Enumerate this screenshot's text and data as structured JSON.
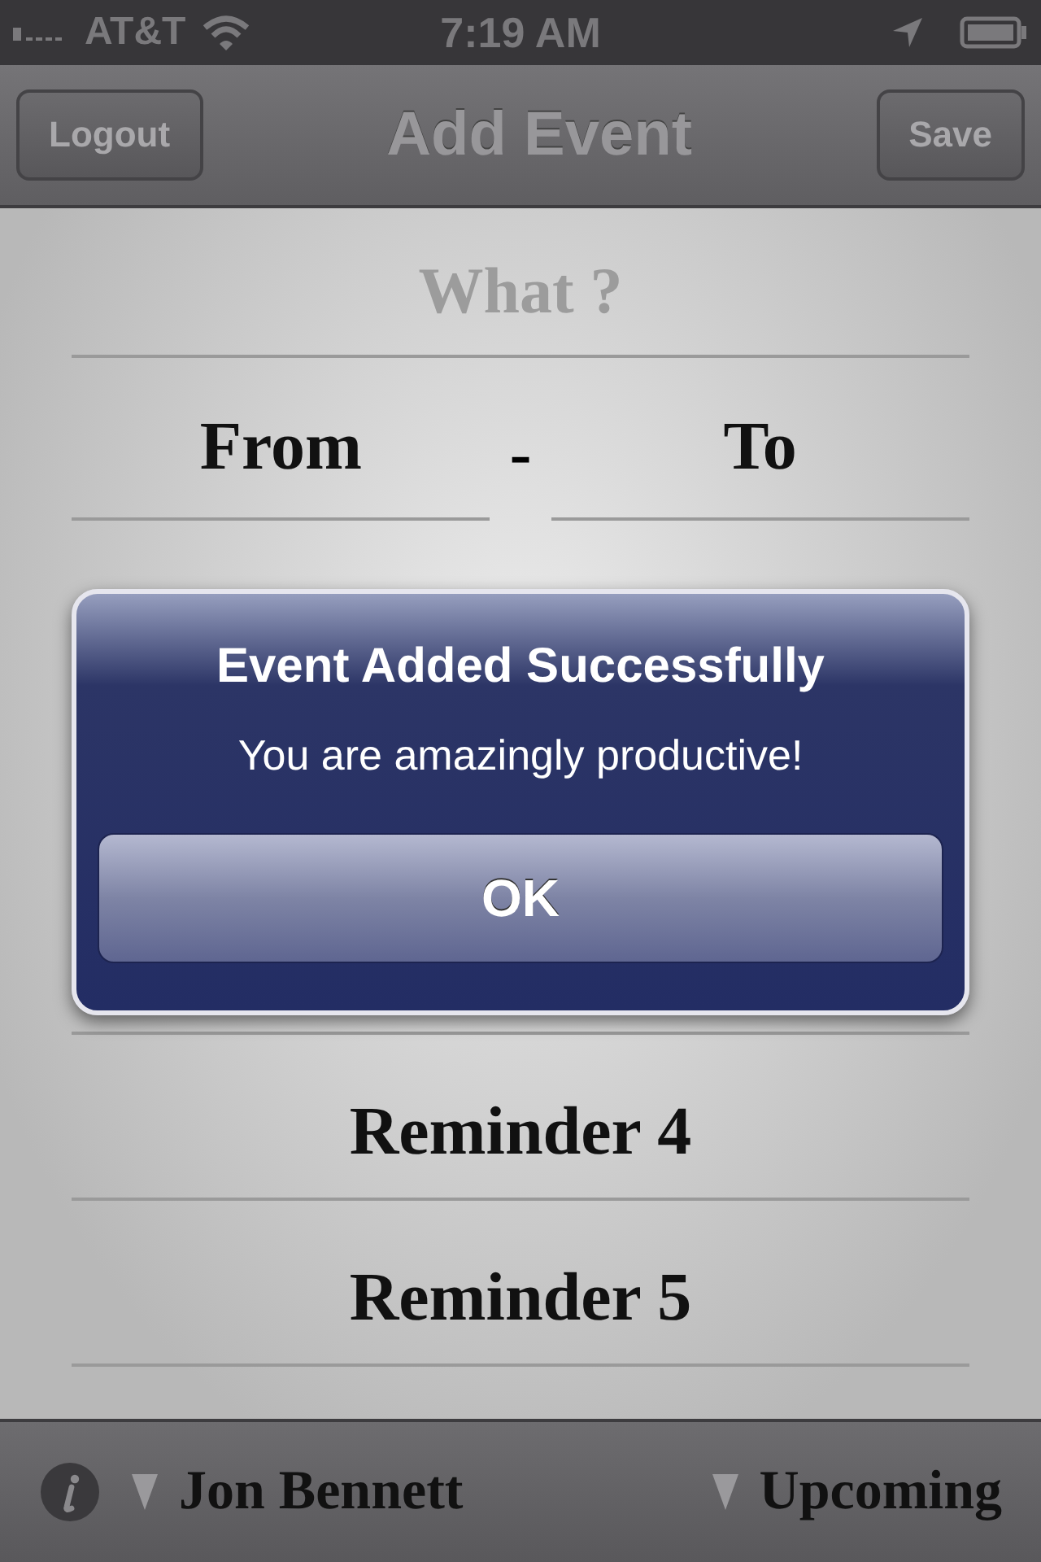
{
  "status_bar": {
    "carrier": "AT&T",
    "time": "7:19 AM"
  },
  "nav_bar": {
    "left_button": "Logout",
    "title": "Add Event",
    "right_button": "Save"
  },
  "form": {
    "what": {
      "placeholder": "What ?"
    },
    "from": "From",
    "separator": "-",
    "to": "To",
    "reminders": [
      {
        "label": "Reminder 4"
      },
      {
        "label": "Reminder 5"
      }
    ]
  },
  "alert": {
    "title": "Event Added Successfully",
    "message": "You are amazingly productive!",
    "buttons": [
      "OK"
    ]
  },
  "bottom_bar": {
    "user": "Jon Bennett",
    "filter": "Upcoming"
  }
}
